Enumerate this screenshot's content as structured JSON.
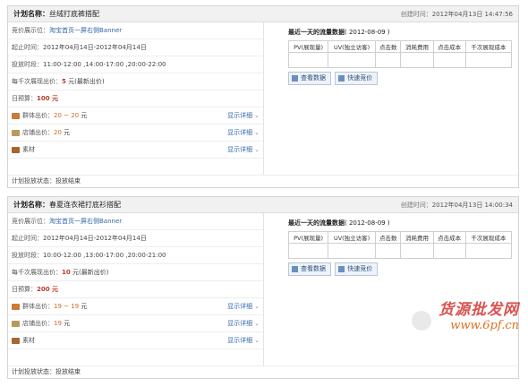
{
  "labels": {
    "plan_name": "计划名称：",
    "created": "创建时间：",
    "position": "竞价展示位：",
    "period": "起止时间：",
    "timeslot": "投放时段：",
    "cpm": "每千次展现出价：",
    "budget": "日预算：",
    "group_price": "群体出价：",
    "shop_price": "店铺出价：",
    "material": "素材",
    "status": "计划投放状态：",
    "show_detail": "显示详细",
    "flow_title": "最近一天的流量数据",
    "view_data": "查看数据",
    "quick_bid": "快速竞价"
  },
  "table_headers": [
    "PV(展现量)",
    "UV(独立访客)",
    "点击数",
    "消耗费用",
    "点击成本",
    "千次展现成本"
  ],
  "plans": [
    {
      "name": "丝绒打底裤搭配",
      "created": "2012年04月13日 14:47:56",
      "position": "淘宝首页一屏右侧Banner",
      "period": "2012年04月14日-2012年04月14日",
      "timeslot": "11:00-12:00 ,14:00-17:00 ,20:00-22:00",
      "cpm_value": "5",
      "cpm_suffix": "元(最新出价)",
      "budget": "100 元",
      "group_price": "20 ~ 20",
      "group_unit": "元",
      "shop_price": "20",
      "shop_unit": "元",
      "status": "投放结束",
      "flow_date": "( 2012-08-09 )"
    },
    {
      "name": "春夏连衣裙打底衫搭配",
      "created": "2012年04月13日 14:00:34",
      "position": "淘宝首页一屏右侧Banner",
      "period": "2012年04月14日-2012年04月14日",
      "timeslot": "10:00-12:00 ,13:00-17:00 ,20:00-21:00",
      "cpm_value": "10",
      "cpm_suffix": "元(最新出价)",
      "budget": "200 元",
      "group_price": "19 ~ 19",
      "group_unit": "元",
      "shop_price": "19",
      "shop_unit": "元",
      "status": "投放结束",
      "flow_date": "( 2012-08-09 )"
    }
  ],
  "watermark": {
    "title": "货源批发网",
    "url": "www.6pf.cn"
  },
  "colors": {
    "accent_link": "#3366aa",
    "price_red": "#c0392b",
    "header_bg": "#f1f1f1"
  }
}
